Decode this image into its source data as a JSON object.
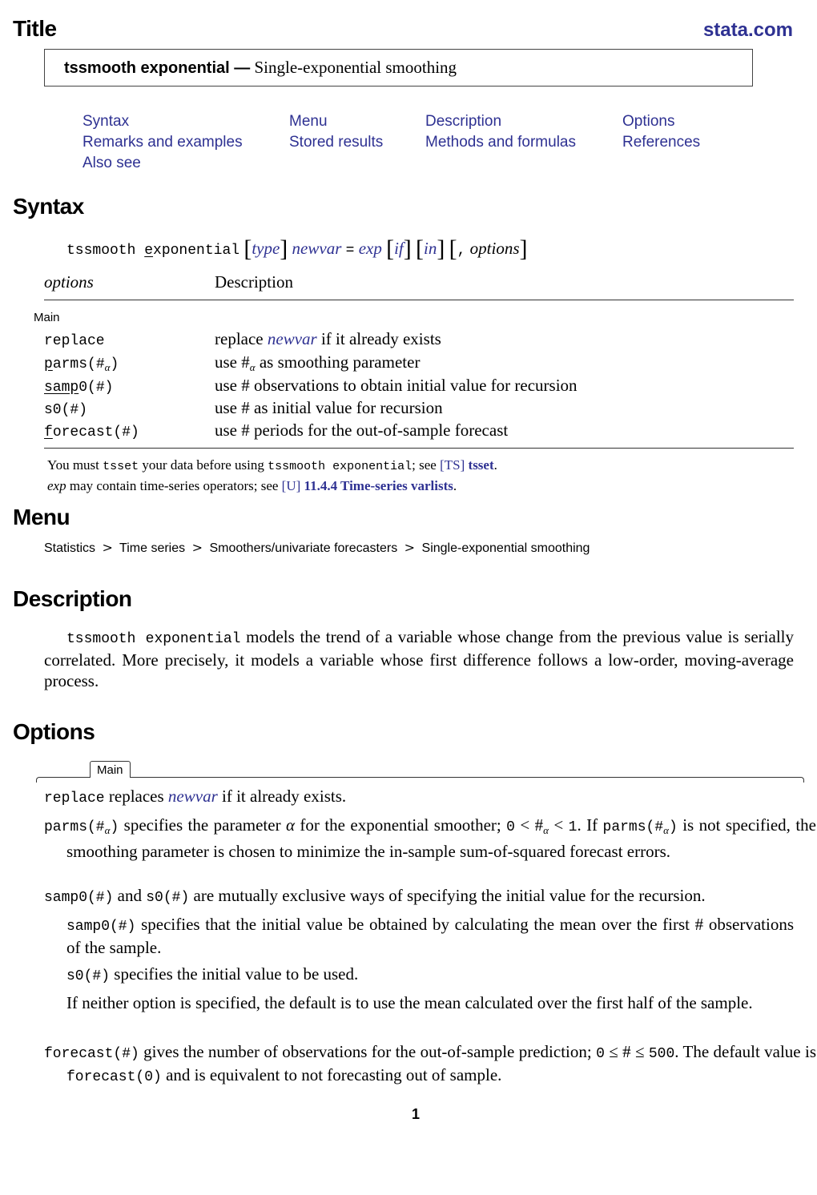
{
  "header": {
    "section_label": "Title",
    "site_link": "stata.com",
    "command": "tssmooth exponential —",
    "command_desc": "Single-exponential smoothing"
  },
  "toc": [
    "Syntax",
    "Menu",
    "Description",
    "Options",
    "Remarks and examples",
    "Stored results",
    "Methods and formulas",
    "References",
    "Also see"
  ],
  "syntax": {
    "heading": "Syntax",
    "cmd_prefix": "tssmooth ",
    "cmd_ul": "e",
    "cmd_rest": "xponential",
    "type": "type",
    "newvar": "newvar",
    "eq": "=",
    "exp": "exp",
    "if": "if",
    "in": "in",
    "comma": ",",
    "options": "options",
    "table_head_options": "options",
    "table_head_desc": "Description",
    "group_label": "Main",
    "rows": [
      {
        "ul": "",
        "rest": "replace",
        "desc_pre": "replace ",
        "desc_link": "newvar",
        "desc_post": " if it already exists"
      },
      {
        "ul": "p",
        "rest": "arms(#",
        "sub": "α",
        "close": ")",
        "desc_pre": "use #",
        "desc_sub": "α",
        "desc_post": " as smoothing parameter"
      },
      {
        "ul": "samp",
        "rest": "0(#)",
        "desc_pre": "use # observations to obtain initial value for recursion"
      },
      {
        "ul": "",
        "rest": "s0(#)",
        "desc_pre": "use # as initial value for recursion"
      },
      {
        "ul": "f",
        "rest": "orecast(#)",
        "desc_pre": "use # periods for the out-of-sample forecast"
      }
    ],
    "note1_pre": "You must ",
    "note1_code1": "tsset",
    "note1_mid": " your data before using ",
    "note1_code2": "tssmooth exponential",
    "note1_post": "; see ",
    "note1_link_a": "[TS]",
    "note1_link_b": "tsset",
    "note1_end": ".",
    "note2_ital": "exp",
    "note2_mid": " may contain time-series operators; see ",
    "note2_link_a": "[U]",
    "note2_link_b": "11.4.4 Time-series varlists",
    "note2_end": "."
  },
  "menu": {
    "heading": "Menu",
    "path": [
      "Statistics",
      "Time series",
      "Smoothers/univariate forecasters",
      "Single-exponential smoothing"
    ],
    "sep": ">"
  },
  "description": {
    "heading": "Description",
    "code": "tssmooth exponential",
    "text": " models the trend of a variable whose change from the previous value is serially correlated. More precisely, it models a variable whose first difference follows a low-order, moving-average process."
  },
  "options": {
    "heading": "Options",
    "tab_label": "Main",
    "replace_code": "replace",
    "replace_pre": " replaces ",
    "replace_link": "newvar",
    "replace_post": " if it already exists.",
    "parms_code": "parms(#",
    "parms_sub": "α",
    "parms_close": ")",
    "parms_text1": " specifies the parameter ",
    "alpha": "α",
    "parms_text2": " for the exponential smoother; ",
    "parms_zero": "0",
    "lt": " < #",
    "parms_lt2": " < ",
    "parms_one": "1",
    "parms_text3": ". If ",
    "parms_text4": " is not specified, the smoothing parameter is chosen to minimize the in-sample sum-of-squared forecast errors.",
    "mutex_code1": "samp0(#)",
    "mutex_and": " and ",
    "mutex_code2": "s0(#)",
    "mutex_text": " are mutually exclusive ways of specifying the initial value for the recursion.",
    "samp0_code": "samp0(#)",
    "samp0_text": " specifies that the initial value be obtained by calculating the mean over the first # observations of the sample.",
    "s0_code": "s0(#)",
    "s0_text": " specifies the initial value to be used.",
    "neither_text": "If neither option is specified, the default is to use the mean calculated over the first half of the sample.",
    "forecast_code": "forecast(#)",
    "forecast_text1": " gives the number of observations for the out-of-sample prediction; ",
    "forecast_zero": "0",
    "forecast_le": " ≤ # ≤ ",
    "forecast_500": "500",
    "forecast_text2": ". The default value is ",
    "forecast_code2": "forecast(0)",
    "forecast_text3": " and is equivalent to not forecasting out of sample."
  },
  "footer": {
    "page_number": "1"
  }
}
